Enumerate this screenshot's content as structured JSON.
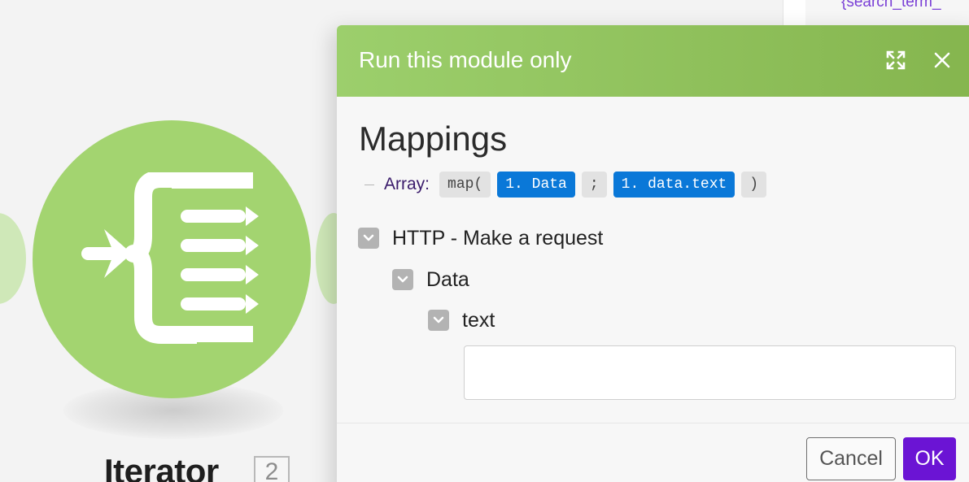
{
  "canvas": {
    "right_panel_text": "{search_term_"
  },
  "module": {
    "title": "Iterator",
    "badge": "2",
    "icon": "iterator-icon",
    "color": "#a3d470"
  },
  "modal": {
    "title": "Run this module only",
    "header_color": "#9ccf6c",
    "expand_icon": "expand-icon",
    "close_icon": "close-icon",
    "section_title": "Mappings",
    "array": {
      "label": "Array:",
      "tokens": [
        "map(",
        "1. Data",
        ";",
        "1. data.text",
        ")"
      ]
    },
    "tree": [
      {
        "label": "HTTP - Make a request",
        "expanded": true
      },
      {
        "label": "Data",
        "expanded": true
      },
      {
        "label": "text",
        "expanded": true
      }
    ],
    "text_input": {
      "value": "",
      "placeholder": ""
    },
    "buttons": {
      "cancel": "Cancel",
      "ok": "OK"
    },
    "ok_color": "#6b14d4"
  }
}
